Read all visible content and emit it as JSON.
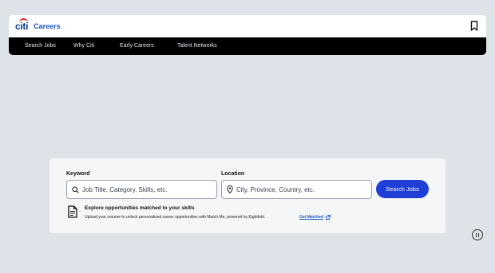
{
  "header": {
    "logo_text": "citi",
    "site_title": "Careers",
    "bookmark_icon": "bookmark-icon"
  },
  "nav": {
    "items": [
      {
        "label": "Search Jobs"
      },
      {
        "label": "Why Citi"
      },
      {
        "label": "Early Careers"
      },
      {
        "label": "Talent Networks"
      }
    ]
  },
  "search": {
    "keyword_label": "Keyword",
    "keyword_placeholder": "Job Title, Category, Skills, etc.",
    "keyword_value": "",
    "location_label": "Location",
    "location_placeholder": "City, Province, Country, etc.",
    "location_value": "",
    "button_label": "Search Jobs"
  },
  "match": {
    "title": "Explore opportunities matched to your skills",
    "description": "Upload your resume to unlock personalized career opportunities with Match Me, powered by Eightfold.",
    "link_label": "Get Matched"
  },
  "colors": {
    "page_bg": "#dde3e9",
    "nav_bg": "#000000",
    "accent": "#1f3fd6",
    "brand_red": "#e01e26",
    "brand_blue": "#0a3d91"
  }
}
